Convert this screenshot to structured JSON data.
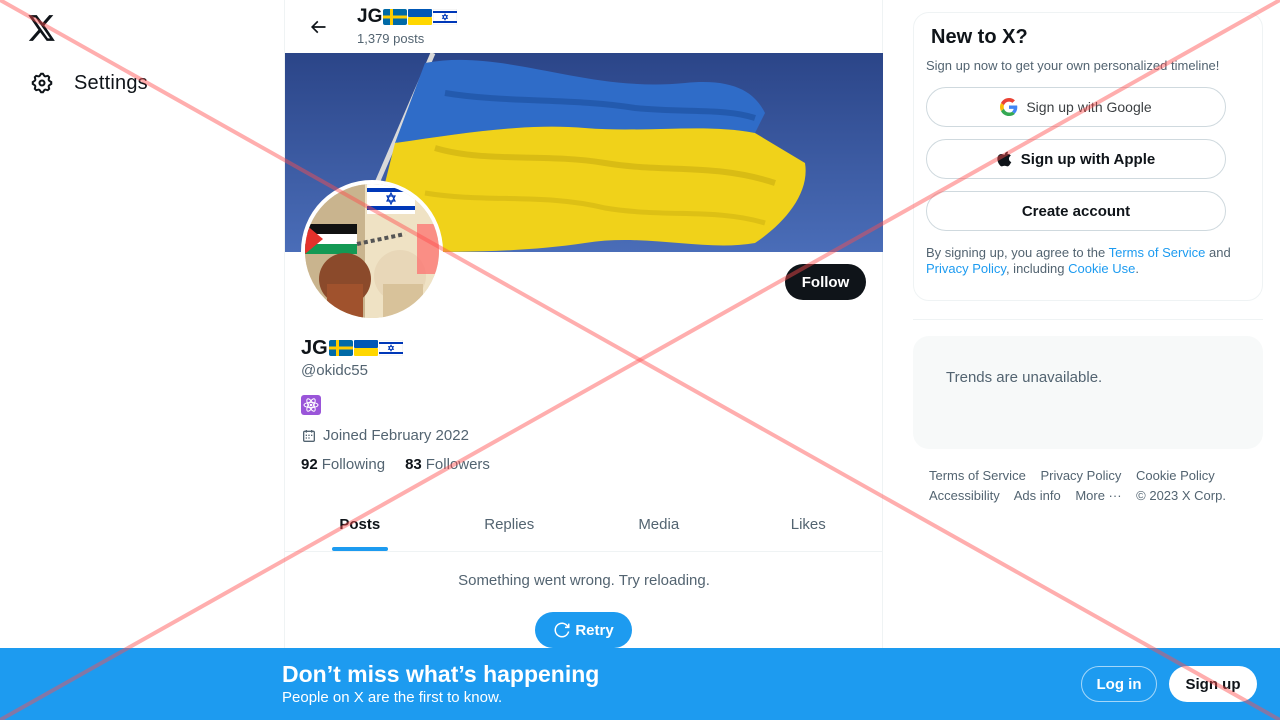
{
  "topbar": {
    "name": "JG",
    "posts_count": "1,379 posts"
  },
  "nav": {
    "settings_label": "Settings"
  },
  "profile": {
    "name": "JG",
    "handle": "@okidc55",
    "joined": "Joined February 2022",
    "following_count": "92",
    "following_label": "Following",
    "followers_count": "83",
    "followers_label": "Followers",
    "follow_label": "Follow"
  },
  "tabs": [
    {
      "label": "Posts",
      "active": true
    },
    {
      "label": "Replies",
      "active": false
    },
    {
      "label": "Media",
      "active": false
    },
    {
      "label": "Likes",
      "active": false
    }
  ],
  "feed": {
    "error_text": "Something went wrong. Try reloading.",
    "retry_label": "Retry"
  },
  "signup_card": {
    "title": "New to X?",
    "subtitle": "Sign up now to get your own personalized timeline!",
    "google_label": "Sign up with Google",
    "apple_label": "Sign up with Apple",
    "create_label": "Create account",
    "legal_prefix": "By signing up, you agree to the ",
    "terms_link": "Terms of Service",
    "legal_and": " and ",
    "privacy_link": "Privacy Policy",
    "legal_including": ", including ",
    "cookie_link": "Cookie Use",
    "legal_end": "."
  },
  "trends": {
    "text": "Trends are unavailable."
  },
  "footer": {
    "terms": "Terms of Service",
    "privacy": "Privacy Policy",
    "cookie": "Cookie Policy",
    "accessibility": "Accessibility",
    "ads": "Ads info",
    "more": "More ···",
    "copyright": "© 2023 X Corp."
  },
  "bottom_bar": {
    "title": "Don’t miss what’s happening",
    "subtitle": "People on X are the first to know.",
    "login_label": "Log in",
    "signup_label": "Sign up"
  },
  "colors": {
    "accent": "#1d9bf0",
    "text_primary": "#0f1419",
    "text_secondary": "#536471",
    "overlay_cross": "#ff4d4d"
  },
  "icons": {
    "logo": "x-logo-icon",
    "settings": "gear-icon",
    "back": "arrow-left-icon",
    "calendar": "calendar-icon",
    "retry": "refresh-icon",
    "google": "google-icon",
    "apple": "apple-icon",
    "bio": "atom-icon"
  }
}
